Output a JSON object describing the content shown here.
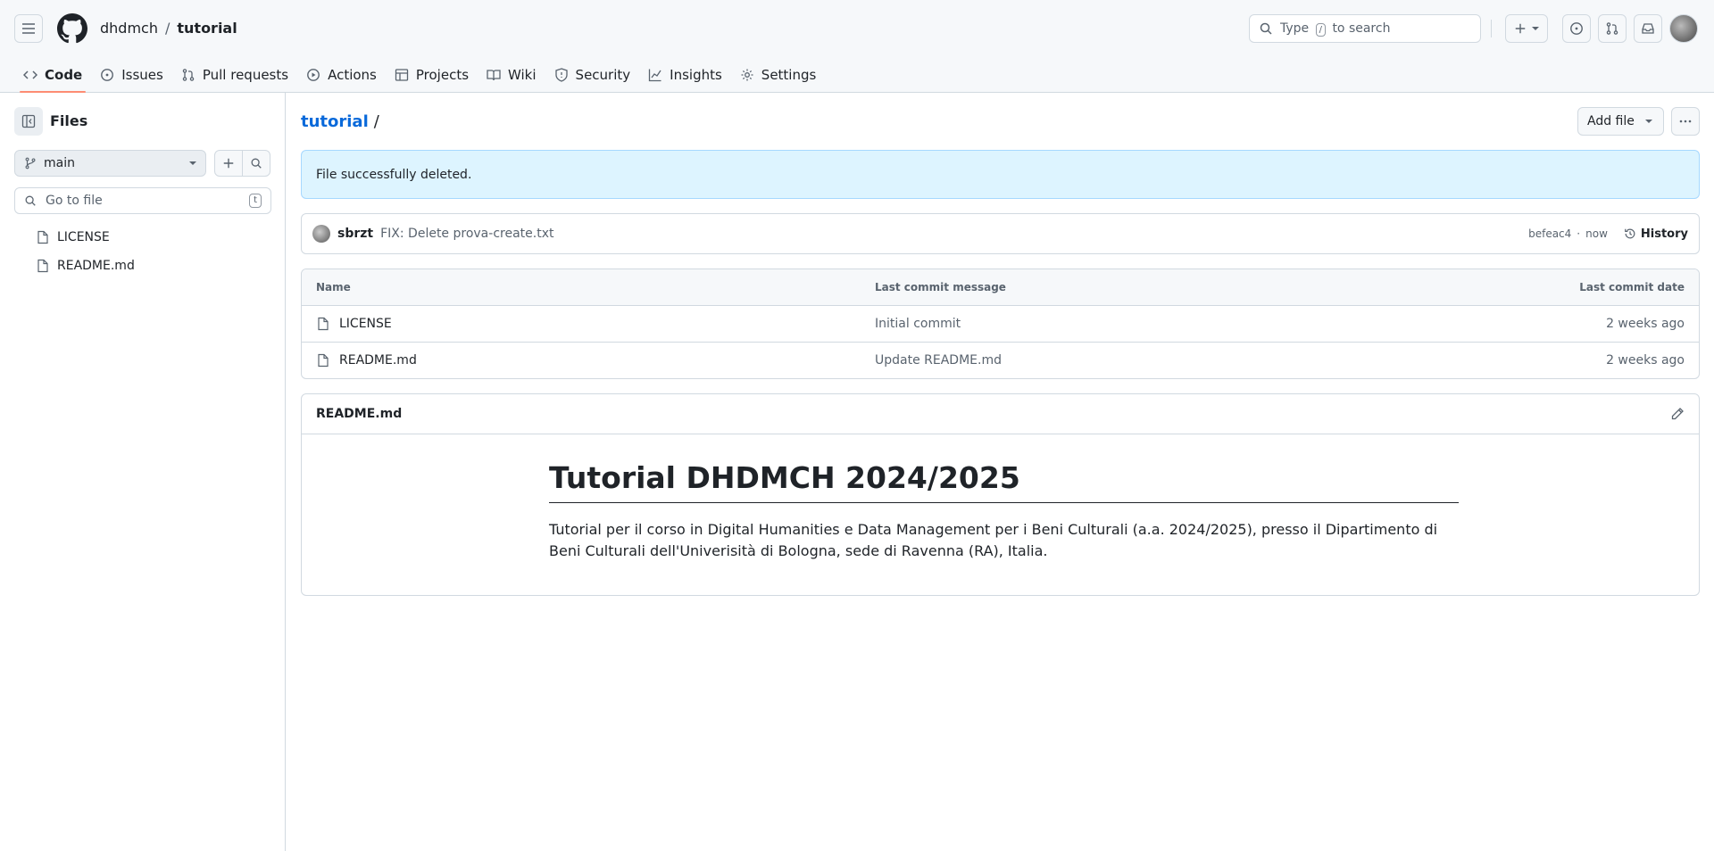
{
  "header": {
    "owner": "dhdmch",
    "separator": "/",
    "repo": "tutorial",
    "search": {
      "prefix": "Type",
      "key": "/",
      "suffix": "to search"
    },
    "tabs": [
      {
        "label": "Code",
        "icon": "code-icon",
        "active": true
      },
      {
        "label": "Issues",
        "icon": "issue-opened-icon"
      },
      {
        "label": "Pull requests",
        "icon": "git-pull-request-icon"
      },
      {
        "label": "Actions",
        "icon": "play-icon"
      },
      {
        "label": "Projects",
        "icon": "table-icon"
      },
      {
        "label": "Wiki",
        "icon": "book-icon"
      },
      {
        "label": "Security",
        "icon": "shield-icon"
      },
      {
        "label": "Insights",
        "icon": "graph-icon"
      },
      {
        "label": "Settings",
        "icon": "gear-icon"
      }
    ]
  },
  "sidebar": {
    "title": "Files",
    "branch": "main",
    "goto_placeholder": "Go to file",
    "goto_key": "t",
    "tree": [
      "LICENSE",
      "README.md"
    ]
  },
  "main": {
    "path_repo": "tutorial",
    "path_sep": "/",
    "add_file": "Add file",
    "flash": "File successfully deleted.",
    "commit": {
      "author": "sbrzt",
      "message": "FIX: Delete prova-create.txt",
      "sha": "befeac4",
      "dot": "·",
      "time": "now",
      "history": "History"
    },
    "table": {
      "headers": {
        "name": "Name",
        "message": "Last commit message",
        "date": "Last commit date"
      },
      "rows": [
        {
          "name": "LICENSE",
          "message": "Initial commit",
          "date": "2 weeks ago"
        },
        {
          "name": "README.md",
          "message": "Update README.md",
          "date": "2 weeks ago"
        }
      ]
    },
    "readme": {
      "filename": "README.md",
      "heading": "Tutorial DHDMCH 2024/2025",
      "body": "Tutorial per il corso in Digital Humanities e Data Management per i Beni Culturali (a.a. 2024/2025), presso il Dipartimento di Beni Culturali dell'Univerisità di Bologna, sede di Ravenna (RA), Italia."
    }
  },
  "colors": {
    "accent": "#0969da",
    "tab_underline": "#fd8c73",
    "flash_bg": "#ddf4ff"
  }
}
